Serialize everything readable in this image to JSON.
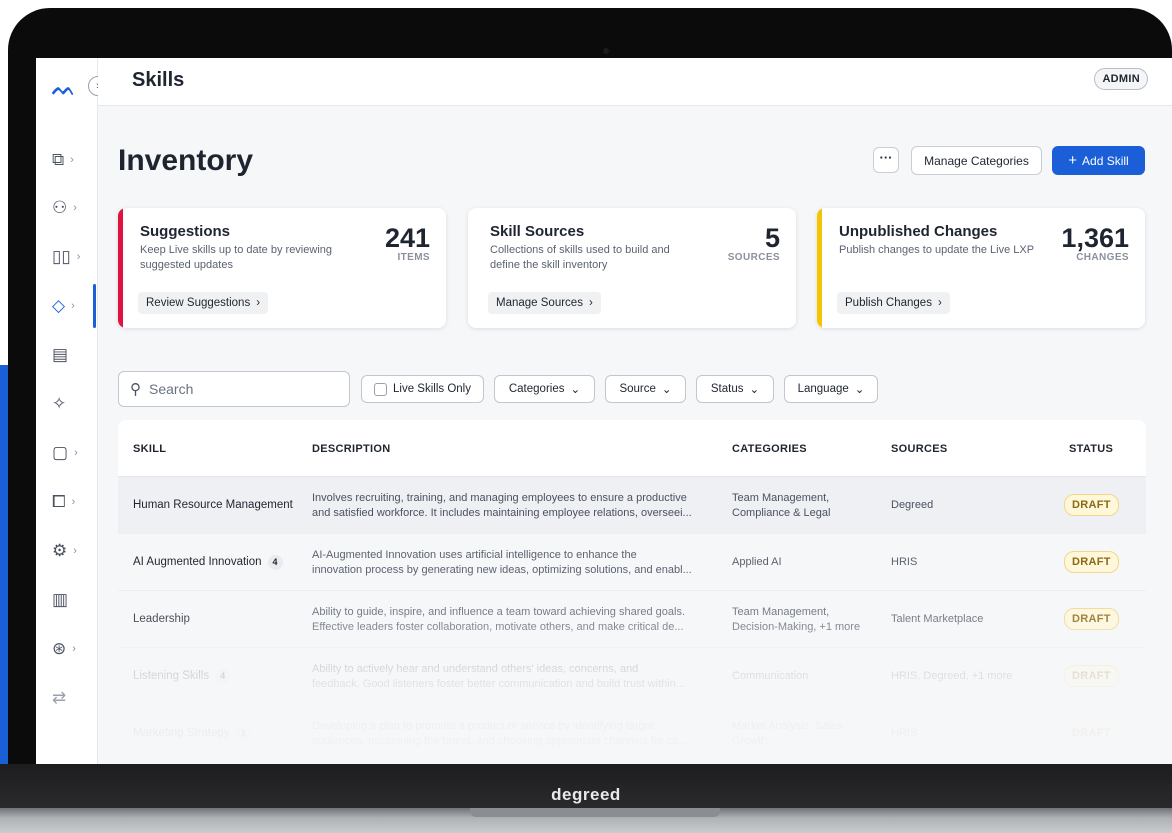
{
  "device": {
    "brand": "degreed"
  },
  "topbar": {
    "title": "Skills",
    "role_badge": "ADMIN"
  },
  "rail": {
    "items": [
      {
        "icon": "presentation-chart-icon"
      },
      {
        "icon": "people-icon"
      },
      {
        "icon": "book-icon"
      },
      {
        "icon": "tag-icon",
        "active": true
      },
      {
        "icon": "store-icon"
      },
      {
        "icon": "sparkle-icon"
      },
      {
        "icon": "report-icon"
      },
      {
        "icon": "puzzle-icon"
      },
      {
        "icon": "settings-icon"
      },
      {
        "icon": "building-icon"
      },
      {
        "icon": "help-icon"
      },
      {
        "icon": "swap-icon"
      }
    ]
  },
  "header": {
    "title": "Inventory",
    "more_label": "···",
    "manage_categories_label": "Manage Categories",
    "add_skill_label": "Add Skill"
  },
  "cards": [
    {
      "title": "Suggestions",
      "description": "Keep Live skills up to date by reviewing suggested updates",
      "value": "241",
      "unit": "ITEMS",
      "action": "Review Suggestions",
      "accent": "#e0123f"
    },
    {
      "title": "Skill Sources",
      "description": "Collections of skills used to build and define the skill inventory",
      "value": "5",
      "unit": "SOURCES",
      "action": "Manage Sources",
      "accent": "#ffffff"
    },
    {
      "title": "Unpublished Changes",
      "description": "Publish changes to update the Live LXP",
      "value": "1,361",
      "unit": "CHANGES",
      "action": "Publish Changes",
      "accent": "#f5c400"
    }
  ],
  "filters": {
    "search_placeholder": "Search",
    "live_only_label": "Live Skills Only",
    "categories_label": "Categories",
    "source_label": "Source",
    "status_label": "Status",
    "language_label": "Language"
  },
  "table": {
    "headers": {
      "skill": "SKILL",
      "description": "DESCRIPTION",
      "categories": "CATEGORIES",
      "sources": "SOURCES",
      "status": "STATUS"
    },
    "rows": [
      {
        "skill": "Human Resource Management",
        "count": "",
        "desc1": "Involves recruiting, training, and managing employees to ensure a productive",
        "desc2": "and satisfied workforce. It includes maintaining employee relations, overseei...",
        "cat1": "Team Management,",
        "cat2": "Compliance & Legal",
        "sources": "Degreed",
        "status": "DRAFT"
      },
      {
        "skill": "AI Augmented Innovation",
        "count": "4",
        "desc1": "AI-Augmented Innovation uses artificial intelligence to enhance the",
        "desc2": "innovation process by generating new ideas, optimizing solutions, and enabl...",
        "cat1": "Applied AI",
        "cat2": "",
        "sources": "HRIS",
        "status": "DRAFT"
      },
      {
        "skill": "Leadership",
        "count": "",
        "desc1": "Ability to guide, inspire, and influence a team toward achieving shared goals.",
        "desc2": "Effective leaders foster collaboration, motivate others, and make critical de...",
        "cat1": "Team Management,",
        "cat2": "Decision-Making, +1 more",
        "sources": "Talent Marketplace",
        "status": "DRAFT"
      },
      {
        "skill": "Listening Skills",
        "count": "4",
        "desc1": "Ability to actively hear and understand others' ideas, concerns, and",
        "desc2": "feedback. Good listeners foster better communication and build trust within...",
        "cat1": "Communication",
        "cat2": "",
        "sources": "HRIS, Degreed, +1 more",
        "status": "DRAFT"
      },
      {
        "skill": "Marketing Strategy",
        "count": "3",
        "desc1": "Developing a plan to promote a product or service by identifying target",
        "desc2": "audiences, positioning the brand, and choosing appropriate channels for co...",
        "cat1": "Market Analysis, Sales",
        "cat2": "Growth",
        "sources": "HRIS",
        "status": "DRAFT"
      }
    ]
  }
}
